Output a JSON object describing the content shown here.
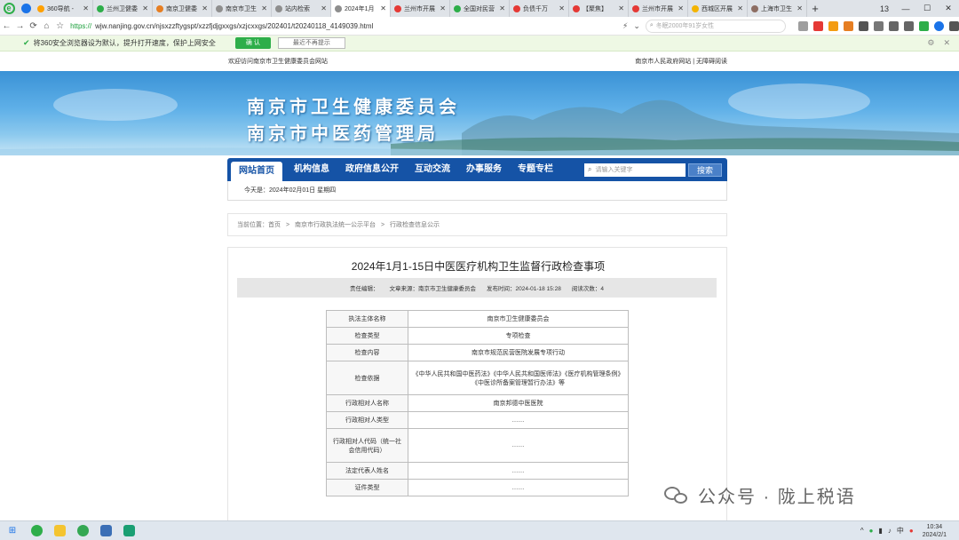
{
  "browser": {
    "tabs": [
      {
        "label": "360导航 -",
        "color": "#ffa000",
        "active": false
      },
      {
        "label": "兰州卫健委",
        "color": "#2eae4a",
        "active": false
      },
      {
        "label": "南京卫健委",
        "color": "#e67e22",
        "active": false
      },
      {
        "label": "南京市卫生",
        "color": "#8e8e8e",
        "active": false
      },
      {
        "label": "站内检索",
        "color": "#8e8e8e",
        "active": false
      },
      {
        "label": "2024年1月",
        "color": "#8e8e8e",
        "active": true
      },
      {
        "label": "兰州市开展",
        "color": "#e53935",
        "active": false
      },
      {
        "label": "全国对民营",
        "color": "#2eae4a",
        "active": false
      },
      {
        "label": "负债千万",
        "color": "#e53935",
        "active": false
      },
      {
        "label": "【聚焦】",
        "color": "#e53935",
        "active": false
      },
      {
        "label": "兰州市开展",
        "color": "#e53935",
        "active": false
      },
      {
        "label": "西城区开展",
        "color": "#f4b400",
        "active": false
      },
      {
        "label": "上海市卫生",
        "color": "#8d6e63",
        "active": false
      }
    ],
    "tab_count": "13",
    "url_secure": "https://",
    "url": "wjw.nanjing.gov.cn/njsxzzftygspt/xzzfjdjgxxgs/xzjcxxgs/202401/t20240118_4149039.html",
    "search_placeholder": "冬眠2000年91岁女性",
    "infobar_text": "将360安全浏览器设为默认，提升打开速度，保护上网安全",
    "infobar_ok": "确 认",
    "infobar_later": "最近不再提示"
  },
  "site": {
    "welcome": "欢迎访问南京市卫生健康委员会网站",
    "top_links": "南京市人民政府网站 | 无障碍阅读",
    "title_line1": "南京市卫生健康委员会",
    "title_line2": "南京市中医药管理局",
    "nav": [
      "网站首页",
      "机构信息",
      "政府信息公开",
      "互动交流",
      "办事服务",
      "专题专栏"
    ],
    "search_placeholder": "请输入关键字",
    "search_button": "搜索",
    "date_text": "今天是：2024年02月01日  星期四",
    "breadcrumb": [
      "当前位置：首页",
      ">",
      "南京市行政执法统一公示平台",
      ">",
      "行政检查信息公示"
    ]
  },
  "article": {
    "title": "2024年1月1-15日中医医疗机构卫生监督行政检查事项",
    "meta": {
      "editor": "责任编辑：",
      "source": "文章来源：南京市卫生健康委员会",
      "published": "发布时间：2024-01-18 15:28",
      "views": "阅读次数：4"
    },
    "rows": [
      {
        "label": "执法主体名称",
        "value": "南京市卫生健康委员会"
      },
      {
        "label": "检查类型",
        "value": "专项检查"
      },
      {
        "label": "检查内容",
        "value": "南京市规范民营医院发展专项行动"
      },
      {
        "label": "检查依据",
        "value": "《中华人民共和国中医药法》《中华人民共和国医师法》《医疗机构管理条例》《中医诊所备案管理暂行办法》等"
      },
      {
        "label": "行政相对人名称",
        "value": "南京邦德中医医院"
      },
      {
        "label": "行政相对人类型",
        "value": "……"
      },
      {
        "label": "行政相对人代码（统一社会信用代码）",
        "value": "……"
      },
      {
        "label": "法定代表人姓名",
        "value": "……"
      },
      {
        "label": "证件类型",
        "value": "……"
      }
    ]
  },
  "watermark": "公众号 · 陇上税语",
  "taskbar": {
    "time": "10:34",
    "date": "2024/2/1"
  }
}
